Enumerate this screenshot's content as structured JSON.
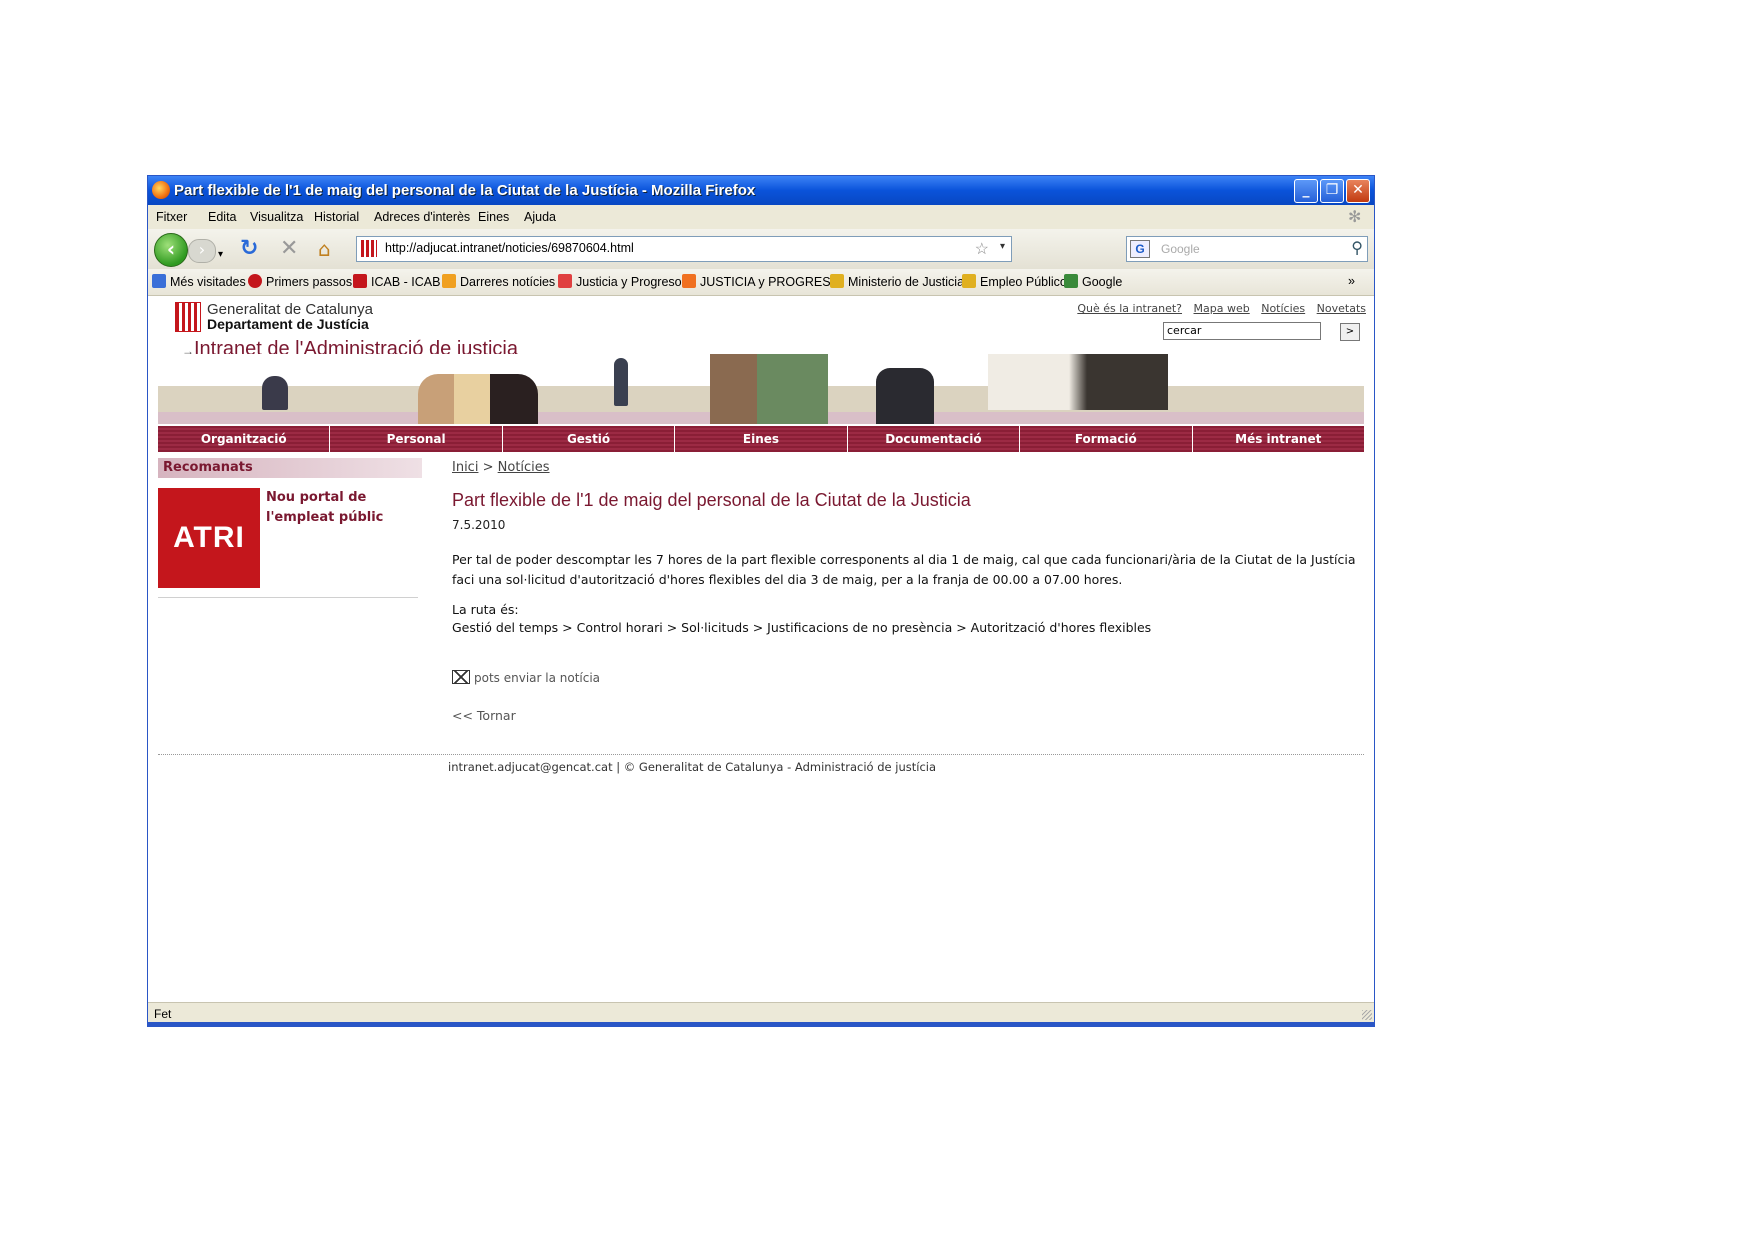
{
  "window": {
    "title": "Part flexible de l'1 de maig del personal de la Ciutat de la Justícia - Mozilla Firefox"
  },
  "menu": [
    "Fitxer",
    "Edita",
    "Visualitza",
    "Historial",
    "Adreces d'interès",
    "Eines",
    "Ajuda"
  ],
  "navbar": {
    "url": "http://adjucat.intranet/noticies/69870604.html",
    "search_placeholder": "Google",
    "search_engine_letter": "G"
  },
  "bookmarks": [
    {
      "label": "Més visitades",
      "color": "#3a6fd8"
    },
    {
      "label": "Primers passos",
      "color": "#c4161c"
    },
    {
      "label": "ICAB - ICAB",
      "color": "#c4161c"
    },
    {
      "label": "Darreres notícies",
      "color": "#f0a020"
    },
    {
      "label": "Justicia y Progreso",
      "color": "#e04040"
    },
    {
      "label": "JUSTICIA y PROGRESO",
      "color": "#f07020"
    },
    {
      "label": "Ministerio de Justicia",
      "color": "#e0b020"
    },
    {
      "label": "Empleo Público",
      "color": "#e0b020"
    },
    {
      "label": "Google",
      "color": "#3a8a3a"
    }
  ],
  "site": {
    "gov_line1": "Generalitat de Catalunya",
    "gov_line2": "Departament de Justícia",
    "intranet_title": "Intranet de l'Administració de justicia",
    "top_links": [
      "Què és la intranet?",
      "Mapa web",
      "Notícies",
      "Novetats"
    ],
    "search_value": "cercar",
    "search_button": ">",
    "nav": [
      "Organització",
      "Personal",
      "Gestió",
      "Eines",
      "Documentació",
      "Formació",
      "Més intranet"
    ]
  },
  "sidebar": {
    "heading": "Recomanats",
    "atri_logo": "ATRI",
    "atri_text": "Nou portal de l'empleat públic"
  },
  "article": {
    "crumb_home": "Inici",
    "crumb_sep": ">",
    "crumb_news": "Notícies",
    "title": "Part flexible de l'1 de maig del personal de la Ciutat de la Justicia",
    "date": "7.5.2010",
    "para1": "Per tal de poder descomptar les 7 hores de la part flexible corresponents al dia 1 de maig, cal que cada funcionari/ària de la Ciutat de la Justícia faci una sol·licitud d'autorització d'hores flexibles del dia 3 de maig, per a la franja de 00.00 a 07.00 hores.",
    "route_label": "La ruta és:",
    "route": "Gestió del temps > Control horari > Sol·licituds > Justificacions de no presència  > Autorització d'hores flexibles",
    "send": "pots enviar la notícia",
    "back": "<< Tornar"
  },
  "footer": "intranet.adjucat@gencat.cat | © Generalitat de Catalunya - Administració de justícia",
  "status": "Fet"
}
